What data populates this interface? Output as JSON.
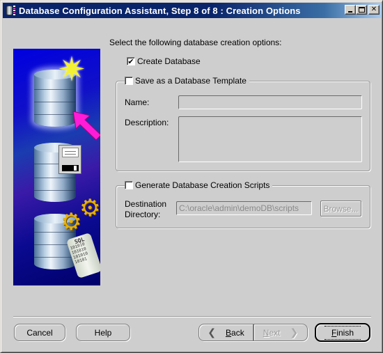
{
  "window": {
    "title": "Database Configuration Assistant, Step 8 of 8 : Creation Options",
    "app_icon": "database-app-icon",
    "controls": {
      "minimize": "minimize-icon",
      "maximize": "maximize-icon",
      "close": "close-icon",
      "close_glyph": "✕"
    }
  },
  "side_image": {
    "description": "Decorative wizard illustration: three database cylinders with star, pink arrow, floppy disk, gears and SQL scroll",
    "scroll_title": "SQL",
    "scroll_lines": [
      "101010",
      "101010",
      "101010",
      "10101"
    ]
  },
  "main": {
    "intro": "Select the following database creation options:",
    "create_database": {
      "label": "Create Database",
      "checked": true,
      "check_glyph": "✔"
    },
    "template_group": {
      "label": "Save as a Database Template",
      "checked": false,
      "name_label": "Name:",
      "name_value": "",
      "description_label": "Description:",
      "description_value": ""
    },
    "scripts_group": {
      "label": "Generate Database Creation Scripts",
      "checked": false,
      "destination_label_line1": "Destination",
      "destination_label_line2": "Directory:",
      "destination_value": "C:\\oracle\\admin\\demoDB\\scripts",
      "browse_label": "Browse..."
    }
  },
  "footer": {
    "cancel": "Cancel",
    "help": "Help",
    "back_mnemonic": "B",
    "back_rest": "ack",
    "next_mnemonic": "N",
    "next_rest": "ext",
    "finish_mnemonic": "F",
    "finish_rest": "inish",
    "back_chevron": "❮",
    "next_chevron": "❯"
  }
}
